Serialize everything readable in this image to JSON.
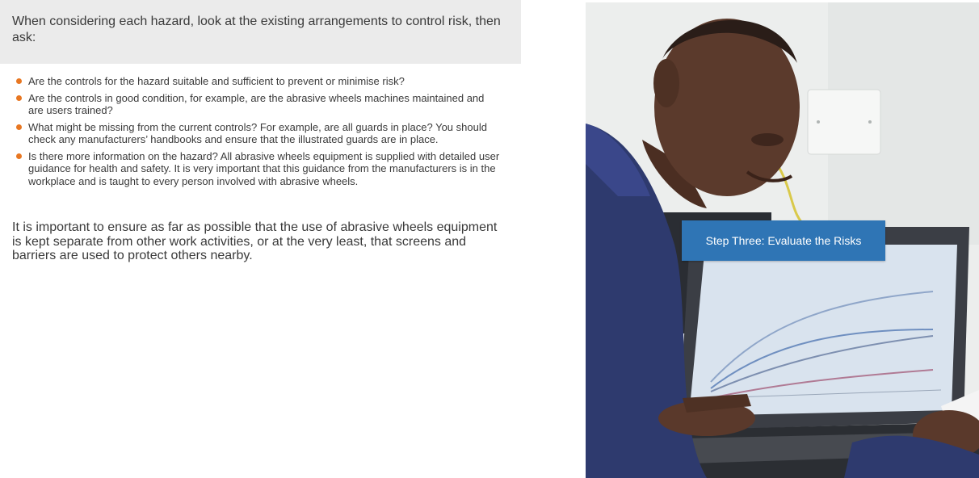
{
  "intro": {
    "text": "When considering each hazard, look at the existing arrangements to control risk, then ask:"
  },
  "questions": [
    "Are the controls for the hazard suitable and sufficient to prevent or minimise risk?",
    "Are the controls in good condition, for example, are the abrasive wheels machines maintained and are users trained?",
    "What might be missing from the current controls? For example, are all guards in place? You should check any manufacturers’ handbooks and ensure that the illustrated guards are in place.",
    "Is there more information on the hazard? All abrasive wheels equipment is supplied with detailed user guidance for health and safety. It is very important that this guidance from the manufacturers is in the workplace and is taught to every person involved with abrasive wheels."
  ],
  "closing": {
    "text": "It is important to ensure as far as possible that the use of abrasive wheels equipment is kept separate from other work activities, or at the very least, that screens and barriers are used to protect others nearby."
  },
  "photo": {
    "description_icon": "man-at-laptop-photo"
  },
  "step_button": {
    "label": "Step Three: Evaluate the Risks"
  },
  "colors": {
    "bullet": "#e87722",
    "button": "#2f75b5",
    "intro_background": "#ebebeb",
    "text": "#3a3a3a"
  }
}
